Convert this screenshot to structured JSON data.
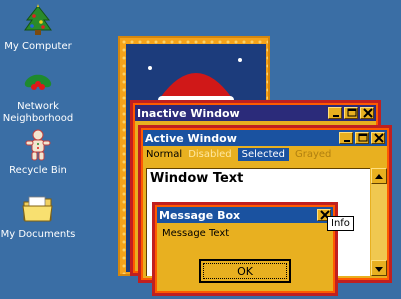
{
  "desktop": {
    "icons": [
      {
        "label": "My Computer",
        "icon": "christmas-tree-icon"
      },
      {
        "label": "Network Neighborhood",
        "icon": "holly-icon"
      },
      {
        "label": "Recycle Bin",
        "icon": "gingerbread-icon"
      },
      {
        "label": "My Documents",
        "icon": "folder-icon"
      }
    ]
  },
  "inactive_window": {
    "title": "Inactive Window"
  },
  "active_window": {
    "title": "Active Window",
    "menu": {
      "normal": "Normal",
      "disabled": "Disabled",
      "selected": "Selected",
      "grayed": "Grayed"
    },
    "window_text": "Window Text"
  },
  "message_box": {
    "title": "Message Box",
    "text": "Message Text",
    "ok_label": "OK",
    "tooltip": "Info"
  },
  "colors": {
    "desktop": "#3a6ea5",
    "window_face": "#e8b020",
    "active_title": "#1a52a0",
    "inactive_title": "#2b2b7a",
    "border_outer": "#c02020"
  }
}
